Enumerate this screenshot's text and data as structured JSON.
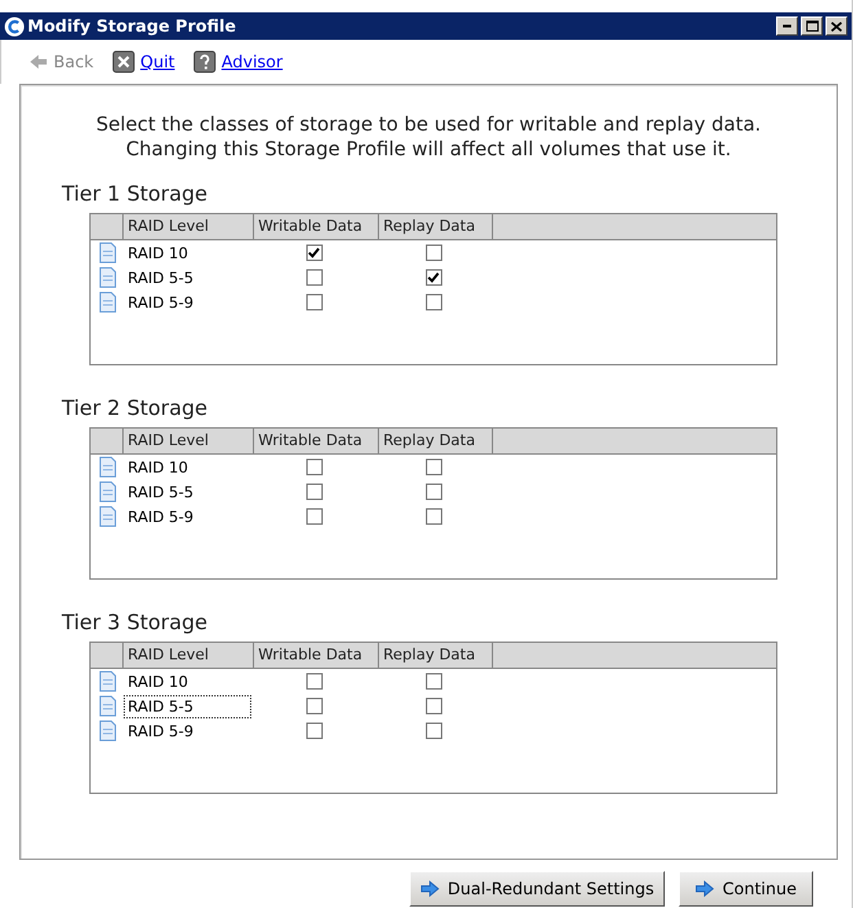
{
  "window": {
    "title": "Modify Storage Profile"
  },
  "toolbar": [
    {
      "label": "Back",
      "kind": "back",
      "disabled": true
    },
    {
      "label": "Quit",
      "kind": "quit",
      "disabled": false
    },
    {
      "label": "Advisor",
      "kind": "advisor",
      "disabled": false
    }
  ],
  "intro": [
    "Select the classes of storage to be used for writable and replay data.",
    "Changing this Storage Profile will affect all volumes that use it."
  ],
  "tiers": [
    {
      "title": "Tier 1 Storage",
      "columns": [
        "RAID Level",
        "Writable Data",
        "Replay Data"
      ],
      "rows": [
        {
          "raid": "RAID 10",
          "writable": true,
          "replay": false,
          "focused": false
        },
        {
          "raid": "RAID 5-5",
          "writable": false,
          "replay": true,
          "focused": false
        },
        {
          "raid": "RAID 5-9",
          "writable": false,
          "replay": false,
          "focused": false
        }
      ]
    },
    {
      "title": "Tier 2 Storage",
      "columns": [
        "RAID Level",
        "Writable Data",
        "Replay Data"
      ],
      "rows": [
        {
          "raid": "RAID 10",
          "writable": false,
          "replay": false,
          "focused": false
        },
        {
          "raid": "RAID 5-5",
          "writable": false,
          "replay": false,
          "focused": false
        },
        {
          "raid": "RAID 5-9",
          "writable": false,
          "replay": false,
          "focused": false
        }
      ]
    },
    {
      "title": "Tier 3 Storage",
      "columns": [
        "RAID Level",
        "Writable Data",
        "Replay Data"
      ],
      "rows": [
        {
          "raid": "RAID 10",
          "writable": false,
          "replay": false,
          "focused": false
        },
        {
          "raid": "RAID 5-5",
          "writable": false,
          "replay": false,
          "focused": true
        },
        {
          "raid": "RAID 5-9",
          "writable": false,
          "replay": false,
          "focused": false
        }
      ]
    }
  ],
  "buttons": [
    "Dual-Redundant Settings",
    "Continue"
  ]
}
